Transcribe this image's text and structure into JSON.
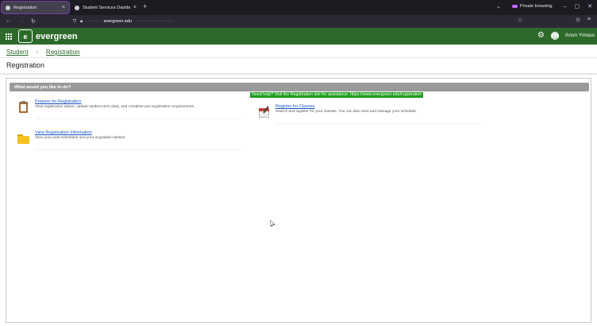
{
  "browser": {
    "tabs": [
      {
        "title": "Registration",
        "active": true
      },
      {
        "title": "Student Services Dashboard",
        "active": false
      }
    ],
    "new_tab_glyph": "+",
    "private_label": "Private browsing",
    "url_host": "evergreen.edu",
    "icons": [
      "back-icon",
      "forward-icon",
      "reload-icon",
      "shield-icon",
      "lock-icon",
      "star-icon",
      "extensions-icon",
      "menu-icon"
    ]
  },
  "header": {
    "brand": "evergreen",
    "logo_glyph": "e",
    "user_name": "Anon Ymous",
    "accent_color": "#2d6a2a"
  },
  "breadcrumb": {
    "items": [
      "Student",
      "Registration"
    ],
    "separator": "›"
  },
  "page_title": "Registration",
  "panel": {
    "heading": "What would you like to do?",
    "help_text": "Need help? Visit the Registration site for assistance. https://www.evergreen.edu/registration",
    "help_color": "#1d9c1d",
    "items": [
      {
        "title": "Prepare for Registration",
        "description": "View registration status, update student term data, and complete pre-registration requirements.",
        "icon": "clipboard-icon"
      },
      {
        "title": "Register for Classes",
        "description": "Search and register for your classes. You can also view and manage your schedule.",
        "icon": "calendar-icon"
      },
      {
        "title": "View Registration Information",
        "description": "View your past schedules and your ungraded classes.",
        "icon": "folder-icon"
      }
    ]
  }
}
